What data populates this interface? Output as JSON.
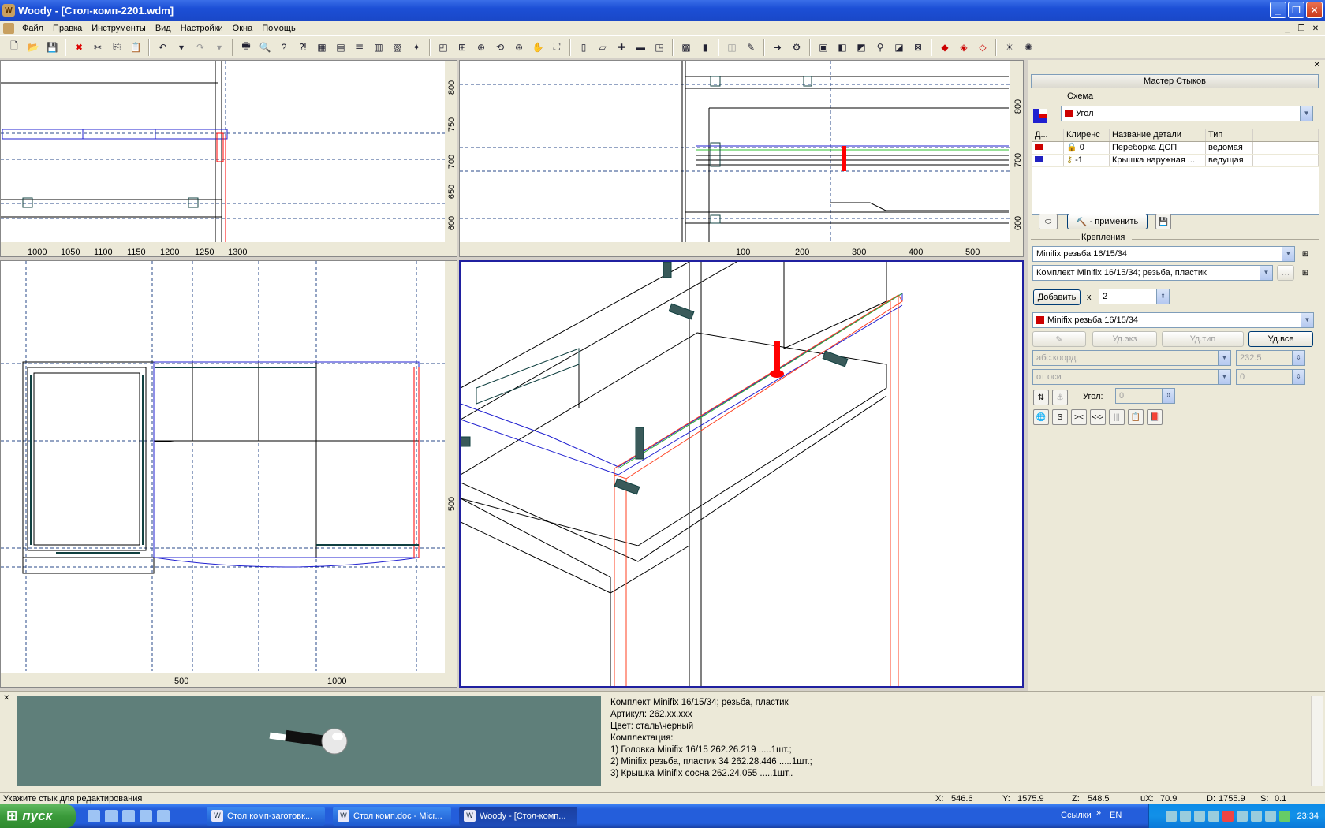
{
  "window": {
    "title": "Woody - [Стол-комп-2201.wdm]"
  },
  "menu": [
    "Файл",
    "Правка",
    "Инструменты",
    "Вид",
    "Настройки",
    "Окна",
    "Помощь"
  ],
  "viewports": {
    "top_left": {
      "x_ticks": [
        "1000",
        "1050",
        "1100",
        "1150",
        "1200",
        "1250",
        "1300"
      ],
      "y_ticks": [
        "800",
        "750",
        "700",
        "650",
        "600"
      ]
    },
    "top_right": {
      "x_ticks": [
        "100",
        "200",
        "300",
        "400",
        "500"
      ],
      "y_ticks": [
        "800",
        "700",
        "600"
      ]
    },
    "bottom_left": {
      "x_ticks": [
        "500",
        "1000"
      ],
      "y_ticks": [
        "500"
      ]
    }
  },
  "panel": {
    "title": "Мастер Стыков",
    "scheme_label": "Схема",
    "scheme_value": "Угол",
    "table": {
      "headers": [
        "Д...",
        "Клиренс",
        "Название детали",
        "Тип"
      ],
      "rows": [
        {
          "clearance": "0",
          "name": "Переборка ДСП",
          "type": "ведомая"
        },
        {
          "clearance": "-1",
          "name": "Крышка наружная ...",
          "type": "ведущая"
        }
      ]
    },
    "apply_label": "- применить",
    "fasteners_label": "Крепления",
    "fastener_combo1": "Minifix резьба 16/15/34",
    "fastener_combo2": "Комплект Minifix 16/15/34; резьба, пластик",
    "add_label": "Добавить",
    "times": "x",
    "count": "2",
    "fastener_combo3": "Minifix резьба 16/15/34",
    "btn_del_inst": "Уд.экз",
    "btn_del_type": "Уд.тип",
    "btn_del_all": "Уд.все",
    "coord_mode": "абс.коорд.",
    "coord_value": "232.5",
    "axis_mode": "от оси",
    "axis_value": "0",
    "angle_label": "Угол:",
    "angle_value": "0",
    "mode_s": "S",
    "mode_x": ">< ",
    "mode_lr": "<->"
  },
  "info": {
    "lines": [
      "Комплект Minifix 16/15/34; резьба, пластик",
      "Артикул: 262.xx.xxx",
      "Цвет: сталь\\черный",
      "Комплектация:",
      "1) Головка Minifix 16/15 262.26.219 .....1шт.;",
      "2) Minifix резьба, пластик 34 262.28.446 .....1шт.;",
      "3) Крышка Minifix сосна 262.24.055 .....1шт.."
    ]
  },
  "status": {
    "hint": "Укажите стык для редактирования",
    "x_label": "X:",
    "x": "546.6",
    "y_label": "Y:",
    "y": "1575.9",
    "z_label": "Z:",
    "z": "548.5",
    "ux_label": "uX:",
    "ux": "70.9",
    "d_label": "D:",
    "d": "1755.9",
    "s_label": "S:",
    "s": "0.1"
  },
  "taskbar": {
    "start": "пуск",
    "tasks": [
      "Стол комп-заготовк...",
      "Стол комп.doc - Micr...",
      "Woody - [Стол-комп..."
    ],
    "links": "Ссылки",
    "lang": "EN",
    "clock": "23:34"
  },
  "colors": {
    "joint_red": "#ff0000",
    "outline_blue": "#2020d0",
    "hardware": "#104040"
  }
}
